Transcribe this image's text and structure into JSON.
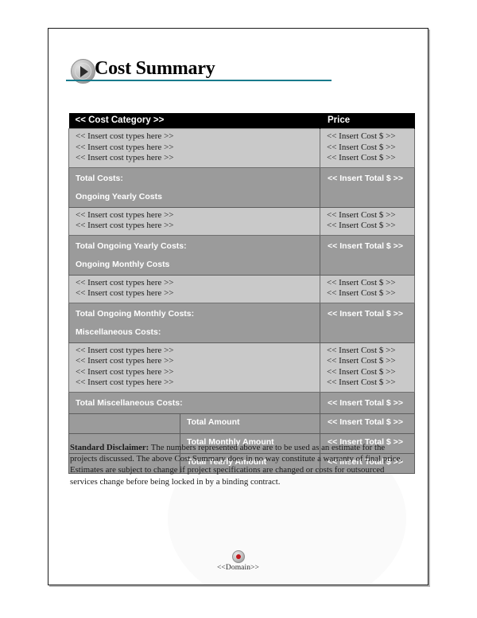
{
  "document": {
    "title": "Cost Summary",
    "title_bullet_icon": "play-circle-icon",
    "accent_color": "#187a8c",
    "header_bg_color": "#000000",
    "data_row_color": "#c9c9c9",
    "total_row_color": "#9b9b9b"
  },
  "table": {
    "headers": {
      "category": "<< Cost Category >>",
      "price": "Price"
    },
    "placeholders": {
      "cost_type": "<< Insert cost types here >>",
      "cost_amount": "<< Insert Cost $ >>",
      "total_amount": "<< Insert Total $ >>"
    },
    "sections": [
      {
        "id": "initial-costs",
        "rows": [
          "<< Insert cost types here >>",
          "<< Insert cost types here >>",
          "<< Insert cost types here >>"
        ],
        "amounts": [
          "<< Insert Cost $ >>",
          "<< Insert Cost $ >>",
          "<< Insert Cost $ >>"
        ],
        "total_label": "Total Costs:",
        "total_value": "<< Insert Total $ >>",
        "next_heading": "Ongoing Yearly Costs"
      },
      {
        "id": "ongoing-yearly-costs",
        "rows": [
          "<< Insert cost types here >>",
          "<< Insert cost types here >>"
        ],
        "amounts": [
          "<< Insert Cost $ >>",
          "<< Insert Cost $ >>"
        ],
        "total_label": "Total Ongoing Yearly Costs:",
        "total_value": "<< Insert Total $ >>",
        "next_heading": "Ongoing Monthly Costs"
      },
      {
        "id": "ongoing-monthly-costs",
        "rows": [
          "<< Insert cost types here >>",
          "<< Insert cost types here >>"
        ],
        "amounts": [
          "<< Insert Cost $ >>",
          "<< Insert Cost $ >>"
        ],
        "total_label": "Total Ongoing Monthly Costs:",
        "total_value": "<< Insert Total $ >>",
        "next_heading": "Miscellaneous Costs:"
      },
      {
        "id": "miscellaneous-costs",
        "rows": [
          "<< Insert cost types here >>",
          "<< Insert cost types here >>",
          "<< Insert cost types here >>",
          "<< Insert cost types here >>"
        ],
        "amounts": [
          "<< Insert Cost $ >>",
          "<< Insert Cost $ >>",
          "<< Insert Cost $ >>",
          "<< Insert Cost $ >>"
        ],
        "total_label": "Total Miscellaneous Costs:",
        "total_value": "<< Insert Total $ >>",
        "next_heading": ""
      }
    ],
    "summary_rows": [
      {
        "label": "Total Amount",
        "value": "<< Insert Total $ >>"
      },
      {
        "label": "Total Monthly Amount",
        "value": "<< Insert Total $ >>"
      },
      {
        "label": "Total Yearly Amount",
        "value": "<< Insert Total $ >>"
      }
    ]
  },
  "disclaimer": {
    "label": "Standard Disclaimer:",
    "body": " The numbers represented above are to be used as an estimate for the projects discussed. The above Cost Summary does in no way constitute a warranty of final price. Estimates are subject to change if project specifications are changed or costs for outsourced services change before being locked in by a binding contract."
  },
  "footer": {
    "bullet_icon": "dot-circle-icon",
    "text": "<<Domain>>"
  }
}
